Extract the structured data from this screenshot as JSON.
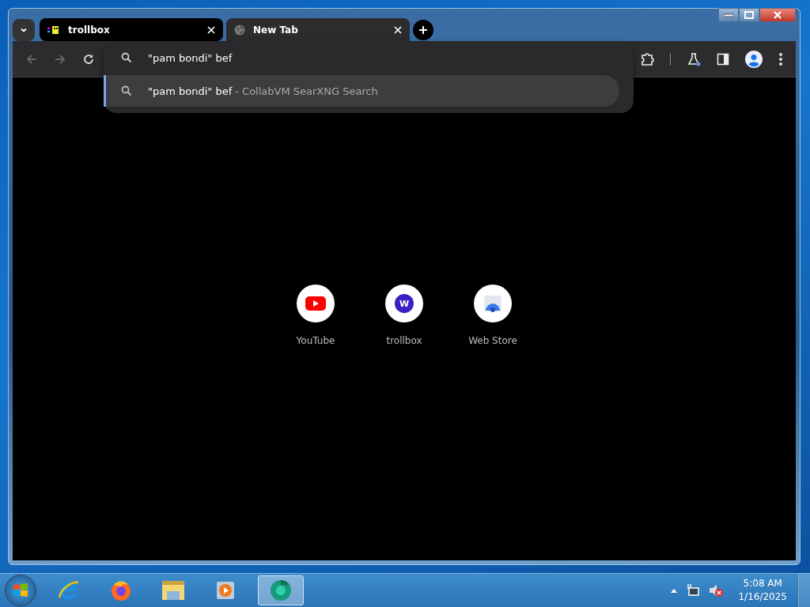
{
  "tabs": [
    {
      "title": "trollbox",
      "selected": false,
      "kind": "pixel"
    },
    {
      "title": "New Tab",
      "selected": true,
      "kind": "globe"
    }
  ],
  "omnibox": {
    "value": "\"pam bondi\" bef"
  },
  "suggestions": [
    {
      "query": "\"pam bondi\" bef",
      "separator": "-",
      "source": "CollabVM SearXNG Search",
      "selected": true
    }
  ],
  "shortcuts": [
    {
      "title": "YouTube",
      "kind": "youtube"
    },
    {
      "title": "trollbox",
      "kind": "letter",
      "letter": "W"
    },
    {
      "title": "Web Store",
      "kind": "store"
    }
  ],
  "taskbar": {
    "apps": [
      {
        "kind": "ie",
        "selected": false
      },
      {
        "kind": "firefox",
        "selected": false
      },
      {
        "kind": "explorer",
        "selected": false
      },
      {
        "kind": "media",
        "selected": false
      },
      {
        "kind": "chrome",
        "selected": true
      }
    ],
    "time": "5:08 AM",
    "date": "1/16/2025"
  }
}
